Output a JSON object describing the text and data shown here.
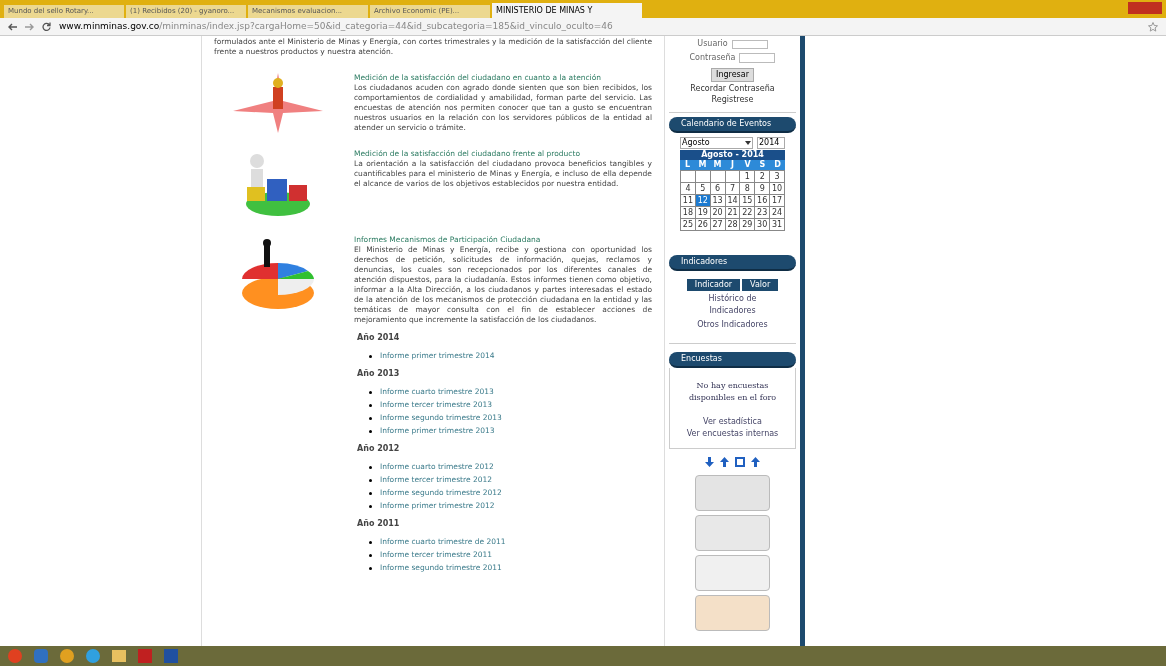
{
  "browser": {
    "tabs": [
      {
        "title": "Mundo del sello Rotary...",
        "selected": false
      },
      {
        "title": "(1) Recibidos (20) - gyanoro...",
        "selected": false
      },
      {
        "title": "Mecanismos evaluacion...",
        "selected": false
      },
      {
        "title": "Archivo Economic (PE)...",
        "selected": false
      },
      {
        "title": "MINISTERIO DE MINAS Y",
        "selected": true
      }
    ],
    "url_domain": "www.minminas.gov.co",
    "url_path": "/minminas/index.jsp?cargaHome=50&id_categoria=44&id_subcategoria=185&id_vinculo_oculto=46"
  },
  "content": {
    "intro": "formulados ante el Ministerio de Minas y Energía, con cortes trimestrales y la medición de la satisfacción del cliente frente a nuestros productos y nuestra atención.",
    "sections": [
      {
        "kind": "arrows",
        "title": "Medición de la satisfacción del ciudadano en cuanto a la atención",
        "text": "Los ciudadanos acuden con agrado donde sienten que son bien recibidos, los comportamientos de cordialidad y amabilidad, forman parte del servicio. Las encuestas de atención nos permiten conocer que tan a gusto se encuentran nuestros usuarios en la relación con los servidores públicos de la entidad al atender un servicio o trámite."
      },
      {
        "kind": "blocks",
        "title": "Medición de la satisfacción del ciudadano frente al producto",
        "text": "La orientación a la satisfacción del ciudadano provoca beneficios tangibles y cuantificables para el ministerio de Minas y Energía, e incluso de ella depende el alcance de varios de los objetivos establecidos por nuestra entidad."
      },
      {
        "kind": "pie",
        "title": "Informes Mecanismos de Participación Ciudadana",
        "text": "El Ministerio de Minas y Energía, recibe y gestiona con oportunidad los derechos de petición, solicitudes de información, quejas, reclamos y denuncias, los cuales son recepcionados por los diferentes canales de atención dispuestos, para la ciudadanía. Estos informes tienen como objetivo, informar a la Alta Dirección, a los ciudadanos y partes interesadas el estado de la atención de los mecanismos de protección ciudadana en la entidad y las temáticas de mayor consulta con el fin de establecer acciones de mejoramiento que incremente la satisfacción de los ciudadanos."
      }
    ],
    "years": [
      {
        "year": "Año 2014",
        "reports": [
          "Informe primer trimestre 2014"
        ]
      },
      {
        "year": "Año 2013",
        "reports": [
          "Informe cuarto trimestre 2013",
          "Informe tercer trimestre 2013",
          "Informe segundo trimestre 2013",
          "Informe primer trimestre 2013"
        ]
      },
      {
        "year": "Año 2012",
        "reports": [
          "Informe cuarto trimestre 2012",
          "Informe tercer trimestre 2012",
          "Informe segundo trimestre 2012",
          "Informe primer trimestre 2012"
        ]
      },
      {
        "year": "Año 2011",
        "reports": [
          "Informe cuarto trimestre de 2011",
          "Informe tercer trimestre 2011",
          "Informe segundo trimestre 2011"
        ]
      }
    ]
  },
  "sidebar": {
    "login": {
      "user_label": "Usuario",
      "password_label": "Contraseña",
      "button": "Ingresar",
      "links": [
        "Recordar Contraseña",
        "Registrese"
      ]
    },
    "calendar": {
      "heading": "Calendario de Eventos",
      "month_select": "Agosto",
      "year_field": "2014",
      "title": "Agosto - 2014",
      "weekdays": [
        "L",
        "M",
        "M",
        "J",
        "V",
        "S",
        "D"
      ],
      "days": [
        {
          "selected": false
        },
        {
          "selected": false
        },
        {
          "selected": false
        },
        {
          "selected": false
        },
        {
          "day": "1",
          "selected": false
        },
        {
          "day": "2",
          "selected": false
        },
        {
          "day": "3",
          "selected": false
        },
        {
          "day": "4",
          "selected": false
        },
        {
          "day": "5",
          "selected": false
        },
        {
          "day": "6",
          "selected": false
        },
        {
          "day": "7",
          "selected": false
        },
        {
          "day": "8",
          "selected": false
        },
        {
          "day": "9",
          "selected": false
        },
        {
          "day": "10",
          "selected": false
        },
        {
          "day": "11",
          "selected": false
        },
        {
          "day": "12",
          "selected": true
        },
        {
          "day": "13",
          "selected": false
        },
        {
          "day": "14",
          "selected": false
        },
        {
          "day": "15",
          "selected": false
        },
        {
          "day": "16",
          "selected": false
        },
        {
          "day": "17",
          "selected": false
        },
        {
          "day": "18",
          "selected": false
        },
        {
          "day": "19",
          "selected": false
        },
        {
          "day": "20",
          "selected": false
        },
        {
          "day": "21",
          "selected": false
        },
        {
          "day": "22",
          "selected": false
        },
        {
          "day": "23",
          "selected": false
        },
        {
          "day": "24",
          "selected": false
        },
        {
          "day": "25",
          "selected": false
        },
        {
          "day": "26",
          "selected": false
        },
        {
          "day": "27",
          "selected": false
        },
        {
          "day": "28",
          "selected": false
        },
        {
          "day": "29",
          "selected": false
        },
        {
          "day": "30",
          "selected": false
        },
        {
          "day": "31",
          "selected": false
        }
      ]
    },
    "indicators": {
      "heading": "Indicadores",
      "columns": [
        "Indicador",
        "Valor"
      ],
      "links": [
        "Histórico de Indicadores",
        "Otros Indicadores"
      ]
    },
    "surveys": {
      "heading": "Encuestas",
      "message": "No hay encuestas disponibles en el foro",
      "links": [
        "Ver estadística",
        "Ver encuestas internas"
      ]
    }
  }
}
